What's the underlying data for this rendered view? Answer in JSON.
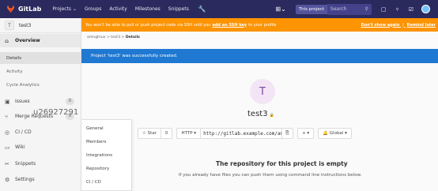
{
  "navbar": {
    "brand": "GitLab",
    "links": [
      "Projects ⌄",
      "Groups",
      "Activity",
      "Milestones",
      "Snippets"
    ],
    "this_project": "This project",
    "search_placeholder": "Search",
    "icons": [
      "wrench-icon",
      "plus-icon",
      "search-icon",
      "issues-icon",
      "merge-request-icon",
      "todo-icon",
      "avatar"
    ]
  },
  "sidebar": {
    "project_letter": "T",
    "project_name": "test3",
    "overview": "Overview",
    "sub_items": [
      "Details",
      "Activity",
      "Cycle Analytics"
    ],
    "issues": "Issues",
    "issues_count": "0",
    "merge_requests": "Merge Requests",
    "mr_count": "0",
    "cicd": "CI / CD",
    "wiki": "Wiki",
    "snippets": "Snippets",
    "settings": "Settings",
    "watermark": "u26927291"
  },
  "flyout": {
    "items": [
      "General",
      "Members",
      "Integrations",
      "Repository",
      "CI / CD"
    ]
  },
  "warning": {
    "text_before": "You won't be able to pull or push project code via SSH until you",
    "link": "add an SSH key",
    "text_after": "to your profile",
    "dont_show": "Don't show again",
    "sep": "|",
    "remind": "Remind later"
  },
  "breadcrumb": {
    "user": "amngtnux",
    "sep1": ">",
    "project": "test3",
    "sep2": ">",
    "current": "Details"
  },
  "flash": {
    "message": "Project 'test3' was successfully created."
  },
  "project": {
    "letter": "T",
    "title": "test3",
    "lock_icon": "🔒"
  },
  "controls": {
    "star": "☆ Star",
    "star_count": "0",
    "protocol": "HTTP ▾",
    "url": "http://gitlab.example.com/amn",
    "add": "+ ▾",
    "notify": "🔔 Global ▾"
  },
  "empty": {
    "title": "The repository for this project is empty",
    "subtitle": "If you already have files you can push them using command line instructions below."
  },
  "colors": {
    "navbar": "#2b2a5e",
    "warning": "#fc9403",
    "flash": "#1f78d1"
  }
}
